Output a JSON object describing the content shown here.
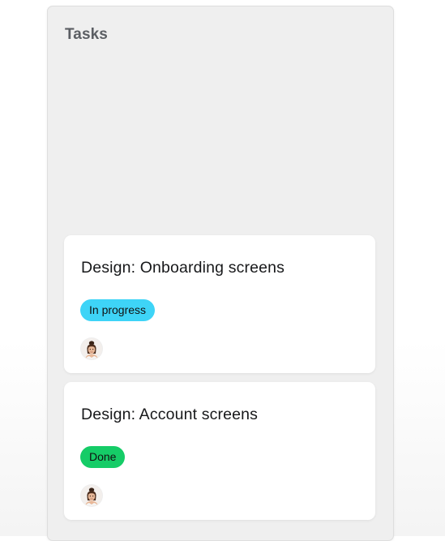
{
  "board": {
    "column": {
      "title": "Tasks",
      "cards": [
        {
          "title": "Design: Onboarding screens",
          "status": "In progress",
          "status_color": "#3ed4f7",
          "avatar_icon": "person-avatar"
        },
        {
          "title": "Design: Account screens",
          "status": "Done",
          "status_color": "#15cc67",
          "avatar_icon": "person-avatar"
        }
      ]
    }
  },
  "colors": {
    "column_bg": "#efefef",
    "card_bg": "#ffffff",
    "title_text": "#5b5e63"
  }
}
